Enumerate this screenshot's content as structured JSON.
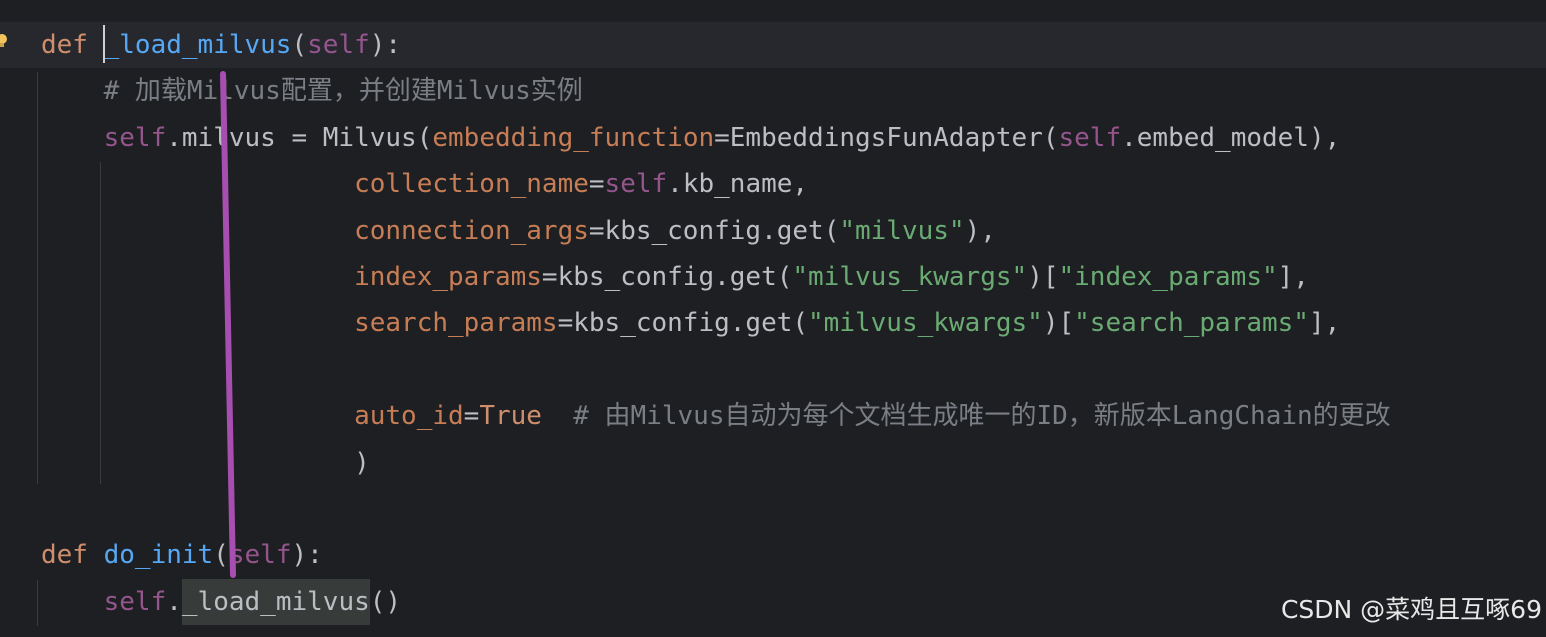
{
  "editor": {
    "lines": [
      {
        "tokens": [
          {
            "t": "def ",
            "c": "kw"
          },
          {
            "t": "_load_milvus",
            "c": "fn"
          },
          {
            "t": "(",
            "c": "plain"
          },
          {
            "t": "self",
            "c": "self"
          },
          {
            "t": "):",
            "c": "plain"
          }
        ]
      },
      {
        "tokens": [
          {
            "t": "    # 加载Milvus配置，并创建Milvus实例",
            "c": "cmt"
          }
        ]
      },
      {
        "tokens": [
          {
            "t": "    ",
            "c": "plain"
          },
          {
            "t": "self",
            "c": "self"
          },
          {
            "t": ".milvus = Milvus(",
            "c": "plain"
          },
          {
            "t": "embedding_function",
            "c": "param"
          },
          {
            "t": "=EmbeddingsFunAdapter(",
            "c": "plain"
          },
          {
            "t": "self",
            "c": "self"
          },
          {
            "t": ".embed_model),",
            "c": "plain"
          }
        ]
      },
      {
        "tokens": [
          {
            "t": "                    ",
            "c": "plain"
          },
          {
            "t": "collection_name",
            "c": "param"
          },
          {
            "t": "=",
            "c": "plain"
          },
          {
            "t": "self",
            "c": "self"
          },
          {
            "t": ".kb_name,",
            "c": "plain"
          }
        ]
      },
      {
        "tokens": [
          {
            "t": "                    ",
            "c": "plain"
          },
          {
            "t": "connection_args",
            "c": "param"
          },
          {
            "t": "=kbs_config.get(",
            "c": "plain"
          },
          {
            "t": "\"milvus\"",
            "c": "str"
          },
          {
            "t": "),",
            "c": "plain"
          }
        ]
      },
      {
        "tokens": [
          {
            "t": "                    ",
            "c": "plain"
          },
          {
            "t": "index_params",
            "c": "param"
          },
          {
            "t": "=kbs_config.get(",
            "c": "plain"
          },
          {
            "t": "\"milvus_kwargs\"",
            "c": "str"
          },
          {
            "t": ")[",
            "c": "plain"
          },
          {
            "t": "\"index_params\"",
            "c": "str"
          },
          {
            "t": "],",
            "c": "plain"
          }
        ]
      },
      {
        "tokens": [
          {
            "t": "                    ",
            "c": "plain"
          },
          {
            "t": "search_params",
            "c": "param"
          },
          {
            "t": "=kbs_config.get(",
            "c": "plain"
          },
          {
            "t": "\"milvus_kwargs\"",
            "c": "str"
          },
          {
            "t": ")[",
            "c": "plain"
          },
          {
            "t": "\"search_params\"",
            "c": "str"
          },
          {
            "t": "],",
            "c": "plain"
          }
        ]
      },
      {
        "tokens": []
      },
      {
        "tokens": [
          {
            "t": "                    ",
            "c": "plain"
          },
          {
            "t": "auto_id",
            "c": "param"
          },
          {
            "t": "=",
            "c": "plain"
          },
          {
            "t": "True",
            "c": "kw"
          },
          {
            "t": "  # 由Milvus自动为每个文档生成唯一的ID，新版本LangChain的更改",
            "c": "cmt"
          }
        ]
      },
      {
        "tokens": [
          {
            "t": "                    )",
            "c": "plain"
          }
        ]
      },
      {
        "tokens": []
      },
      {
        "tokens": [
          {
            "t": "def ",
            "c": "kw"
          },
          {
            "t": "do_init",
            "c": "fn"
          },
          {
            "t": "(",
            "c": "plain"
          },
          {
            "t": "self",
            "c": "self"
          },
          {
            "t": "):",
            "c": "plain"
          }
        ]
      },
      {
        "tokens": [
          {
            "t": "    ",
            "c": "plain"
          },
          {
            "t": "self",
            "c": "self"
          },
          {
            "t": ".",
            "c": "plain"
          },
          {
            "t": "_load_milvus",
            "c": "plain",
            "hl": true
          },
          {
            "t": "()",
            "c": "plain"
          }
        ]
      }
    ]
  },
  "watermark": "CSDN @菜鸡且互啄69",
  "colors": {
    "background": "#1e1f22",
    "keyword": "#cf8e6d",
    "function": "#56a8f5",
    "self": "#94558d",
    "parameter": "#c77d55",
    "string": "#6aab73",
    "comment": "#7a7e85",
    "text": "#bcbec4",
    "annotation_stroke": "#a64fb0"
  },
  "icons": [
    "intention-bulb-icon"
  ]
}
